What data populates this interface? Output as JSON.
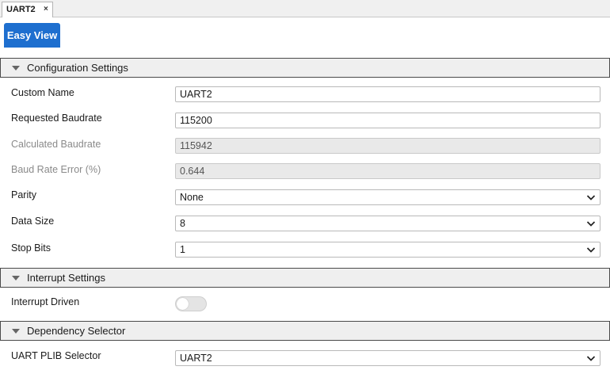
{
  "doc_tab": {
    "label": "UART2",
    "close": "×"
  },
  "view_tab": {
    "label": "Easy View"
  },
  "sections": {
    "config": {
      "title": "Configuration Settings"
    },
    "interrupt": {
      "title": "Interrupt Settings"
    },
    "dependency": {
      "title": "Dependency Selector"
    }
  },
  "config": {
    "custom_name": {
      "label": "Custom Name",
      "value": "UART2"
    },
    "requested_baudrate": {
      "label": "Requested Baudrate",
      "value": "115200"
    },
    "calculated_baudrate": {
      "label": "Calculated Baudrate",
      "value": "115942"
    },
    "baud_rate_error": {
      "label": "Baud Rate Error (%)",
      "value": "0.644"
    },
    "parity": {
      "label": "Parity",
      "value": "None"
    },
    "data_size": {
      "label": "Data Size",
      "value": "8"
    },
    "stop_bits": {
      "label": "Stop Bits",
      "value": "1"
    }
  },
  "interrupt": {
    "interrupt_driven": {
      "label": "Interrupt Driven",
      "enabled": false
    }
  },
  "dependency": {
    "uart_plib_selector": {
      "label": "UART PLIB Selector",
      "value": "UART2"
    }
  },
  "colors": {
    "accent": "#1e6fcf",
    "section_bg": "#efefef",
    "readonly_bg": "#e9e9e9"
  },
  "icons": {
    "section_toggle": "collapse-triangle-icon",
    "dropdown": "chevron-down-icon"
  }
}
